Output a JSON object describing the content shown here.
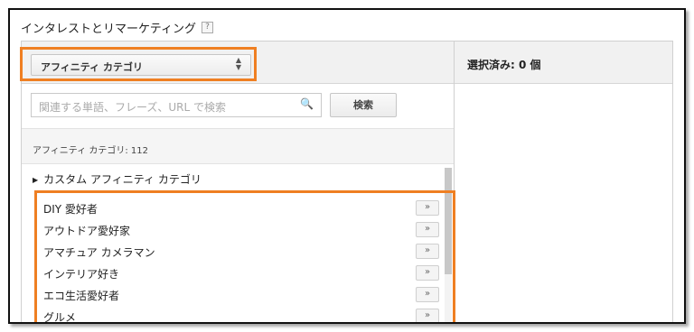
{
  "header": {
    "title": "インタレストとリマーケティング",
    "help": "?"
  },
  "dropdown": {
    "selected": "アフィニティ カテゴリ"
  },
  "search": {
    "placeholder": "関連する単語、フレーズ、URL で検索",
    "button": "検索"
  },
  "category_count": "アフィニティ カテゴリ: 112",
  "custom_affinity": "カスタム アフィニティ カテゴリ",
  "items": [
    "DIY 愛好者",
    "アウトドア愛好家",
    "アマチュア カメラマン",
    "インテリア好き",
    "エコ生活愛好者",
    "グルメ"
  ],
  "add_label": "»",
  "selected_panel": {
    "label": "選択済み: 0 個"
  },
  "colors": {
    "highlight": "#ef7f22"
  }
}
